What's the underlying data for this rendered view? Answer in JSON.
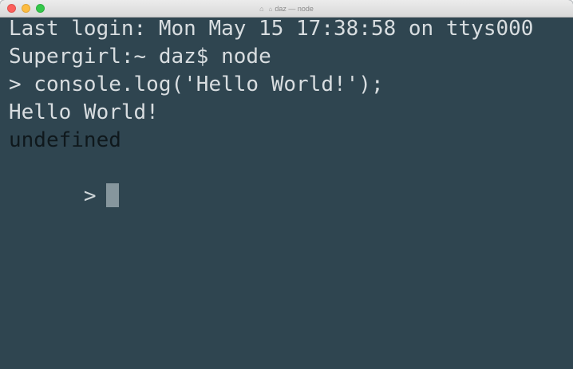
{
  "window": {
    "title": "daz — node",
    "title_icon": "home-icon",
    "title_lock_icon": "lock-icon",
    "traffic_colors": {
      "close": "#fc605c",
      "minimize": "#fdbc40",
      "zoom": "#34c84a"
    },
    "background": "#2f4550"
  },
  "terminal": {
    "lines": [
      "Last login: Mon May 15 17:38:58 on ttys000",
      "Supergirl:~ daz$ node",
      "> console.log('Hello World!');",
      "Hello World!",
      "undefined"
    ],
    "prompt": ">"
  }
}
